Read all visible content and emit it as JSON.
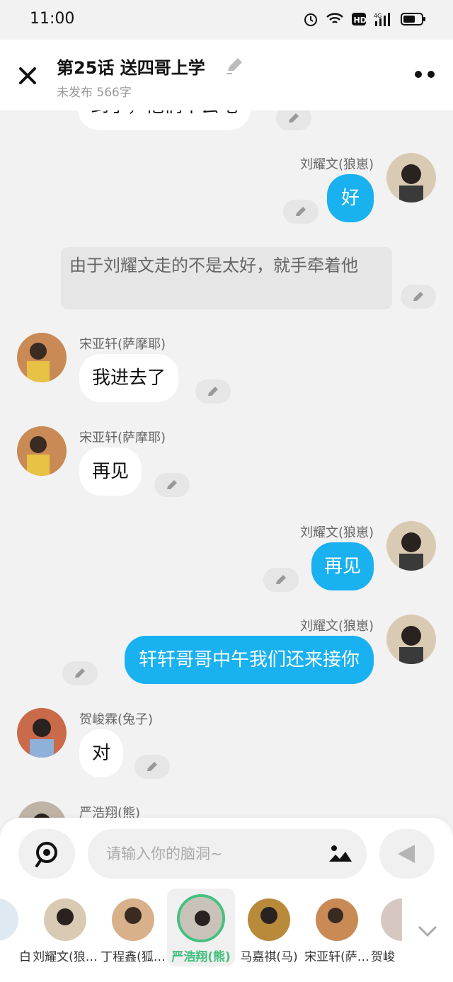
{
  "status": {
    "time": "11:00"
  },
  "header": {
    "title": "第25话   送四哥上学",
    "subtitle": "未发布 566字"
  },
  "colors": {
    "accent": "#1ab1f0",
    "selected": "#45c07e"
  },
  "messages": [
    {
      "type": "left",
      "text": "到了，他们下去吧"
    },
    {
      "type": "right",
      "name": "刘耀文(狼崽)",
      "text": "好"
    },
    {
      "type": "narration",
      "text": "由于刘耀文走的不是太好，就手牵着他"
    },
    {
      "type": "left",
      "name": "宋亚轩(萨摩耶)",
      "text": "我进去了"
    },
    {
      "type": "left",
      "name": "宋亚轩(萨摩耶)",
      "text": "再见"
    },
    {
      "type": "right",
      "name": "刘耀文(狼崽)",
      "text": "再见"
    },
    {
      "type": "right",
      "name": "刘耀文(狼崽)",
      "text": "轩轩哥哥中午我们还来接你"
    },
    {
      "type": "left",
      "name": "贺峻霖(兔子)",
      "text": "对"
    },
    {
      "type": "left",
      "name": "严浩翔(熊)",
      "text": ""
    }
  ],
  "composer": {
    "placeholder": "请输入你的脑洞~"
  },
  "characters": [
    {
      "label": "白"
    },
    {
      "label": "刘耀文(狼…"
    },
    {
      "label": "丁程鑫(狐…"
    },
    {
      "label": "严浩翔(熊)",
      "selected": true
    },
    {
      "label": "马嘉祺(马)"
    },
    {
      "label": "宋亚轩(萨…"
    },
    {
      "label": "贺峻"
    }
  ]
}
